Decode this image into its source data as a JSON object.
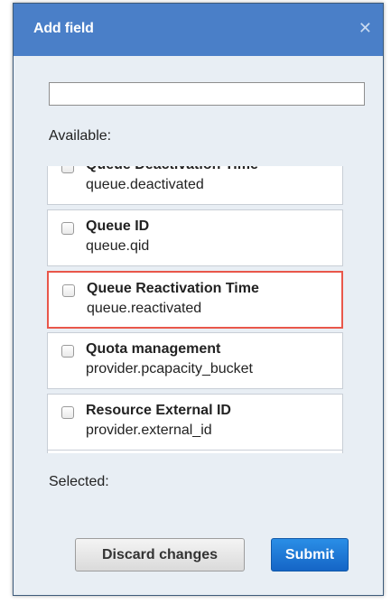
{
  "dialog": {
    "title": "Add field",
    "close_icon": "close-icon",
    "search": {
      "value": "",
      "placeholder": ""
    },
    "available_label": "Available:",
    "selected_label": "Selected:",
    "fields": [
      {
        "name": "Queue Deactivation Time",
        "key": "queue.deactivated",
        "checked": false,
        "highlighted": false
      },
      {
        "name": "Queue ID",
        "key": "queue.qid",
        "checked": false,
        "highlighted": false
      },
      {
        "name": "Queue Reactivation Time",
        "key": "queue.reactivated",
        "checked": false,
        "highlighted": true
      },
      {
        "name": "Quota management",
        "key": "provider.pcapacity_bucket",
        "checked": false,
        "highlighted": false
      },
      {
        "name": "Resource External ID",
        "key": "provider.external_id",
        "checked": false,
        "highlighted": false
      }
    ],
    "buttons": {
      "discard": "Discard changes",
      "submit": "Submit"
    },
    "colors": {
      "titlebar": "#4a7fc8",
      "highlight": "#e9574a",
      "submit": "#1a75d2",
      "dialog_bg": "#e8eef4"
    }
  }
}
